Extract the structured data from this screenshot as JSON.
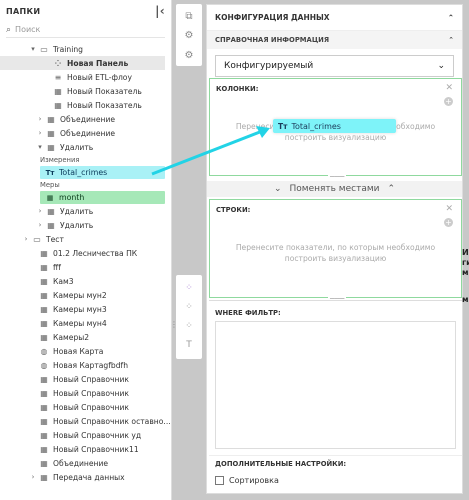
{
  "left_panel": {
    "title": "ПАПКИ",
    "search_placeholder": "Поиск",
    "tree": [
      {
        "label": "Training",
        "icon": "folder-icon",
        "arrow": "▾",
        "indent": 1
      },
      {
        "label": "Новая Панель",
        "icon": "dashboard-icon",
        "arrow": "",
        "indent": 2,
        "active": true
      },
      {
        "label": "Новый ETL-флоу",
        "icon": "database-icon",
        "arrow": "",
        "indent": 2
      },
      {
        "label": "Новый Показатель",
        "icon": "table-icon",
        "arrow": "",
        "indent": 2
      },
      {
        "label": "Новый Показатель",
        "icon": "table-icon",
        "arrow": "",
        "indent": 2
      },
      {
        "label": "Объединение",
        "icon": "table-icon",
        "arrow": "›",
        "indent": 1.5
      },
      {
        "label": "Объединение",
        "icon": "table-icon",
        "arrow": "›",
        "indent": 1.5
      },
      {
        "label": "Удалить",
        "icon": "table-icon",
        "arrow": "▾",
        "indent": 1.5
      }
    ],
    "dimensions_label": "Измерения",
    "dimension_item": "Total_crimes",
    "measures_label": "Меры",
    "measure_item": "month",
    "tree2": [
      {
        "label": "Удалить",
        "icon": "table-icon",
        "arrow": "›",
        "indent": 1.5
      },
      {
        "label": "Удалить",
        "icon": "table-icon",
        "arrow": "›",
        "indent": 1.5
      },
      {
        "label": "Тест",
        "icon": "folder-icon",
        "arrow": "›",
        "indent": 0.5
      },
      {
        "label": "01.2 Лесничества ПК",
        "icon": "table-icon",
        "arrow": "",
        "indent": 1
      },
      {
        "label": "fff",
        "icon": "table-icon",
        "arrow": "",
        "indent": 1
      },
      {
        "label": "Кам3",
        "icon": "table-icon",
        "arrow": "",
        "indent": 1
      },
      {
        "label": "Камеры мун2",
        "icon": "table-icon",
        "arrow": "",
        "indent": 1
      },
      {
        "label": "Камеры мун3",
        "icon": "table-icon",
        "arrow": "",
        "indent": 1
      },
      {
        "label": "Камеры мун4",
        "icon": "table-icon",
        "arrow": "",
        "indent": 1
      },
      {
        "label": "Камеры2",
        "icon": "table-icon",
        "arrow": "",
        "indent": 1
      },
      {
        "label": "Новая Карта",
        "icon": "globe-icon",
        "arrow": "",
        "indent": 1
      },
      {
        "label": "Новая Картаgfbdfh",
        "icon": "globe-icon",
        "arrow": "",
        "indent": 1
      },
      {
        "label": "Новый Справочник",
        "icon": "table-icon",
        "arrow": "",
        "indent": 1
      },
      {
        "label": "Новый Справочник",
        "icon": "table-icon",
        "arrow": "",
        "indent": 1
      },
      {
        "label": "Новый Справочник",
        "icon": "table-icon",
        "arrow": "",
        "indent": 1
      },
      {
        "label": "Новый Справочник оставно...",
        "icon": "table-icon",
        "arrow": "",
        "indent": 1
      },
      {
        "label": "Новый Справочник уд",
        "icon": "table-icon",
        "arrow": "",
        "indent": 1
      },
      {
        "label": "Новый Справочник11",
        "icon": "table-icon",
        "arrow": "",
        "indent": 1
      },
      {
        "label": "Объединение",
        "icon": "table-icon",
        "arrow": "",
        "indent": 1
      },
      {
        "label": "Передача данных",
        "icon": "table-icon",
        "arrow": "›",
        "indent": 1
      }
    ]
  },
  "config": {
    "header": "КОНФИГУРАЦИЯ ДАННЫХ",
    "reference_section": "СПРАВОЧНАЯ ИНФОРМАЦИЯ",
    "type_value": "Конфигурируемый",
    "columns_label": "КОЛОНКИ:",
    "columns_hint": "Перенесите показатели, по которым необходимо построить визуализацию",
    "swap_label": "Поменять местами",
    "rows_label": "СТРОКИ:",
    "rows_hint": "Перенесите показатели, по которым необходимо построить визуализацию",
    "where_label": "WHERE ФИЛЬТР:",
    "extra_label": "ДОПОЛНИТЕЛЬНЫЕ НАСТРОЙКИ:",
    "sort_label": "Сортировка"
  },
  "drag_chip": {
    "label": "Total_crimes"
  },
  "right_fragments": [
    "И",
    "ги",
    "м",
    "м"
  ],
  "colors": {
    "dimension": "#a9f1f6",
    "measure": "#a6e8b8",
    "drop_border": "#8fd99e",
    "arrow": "#22d3e6"
  }
}
